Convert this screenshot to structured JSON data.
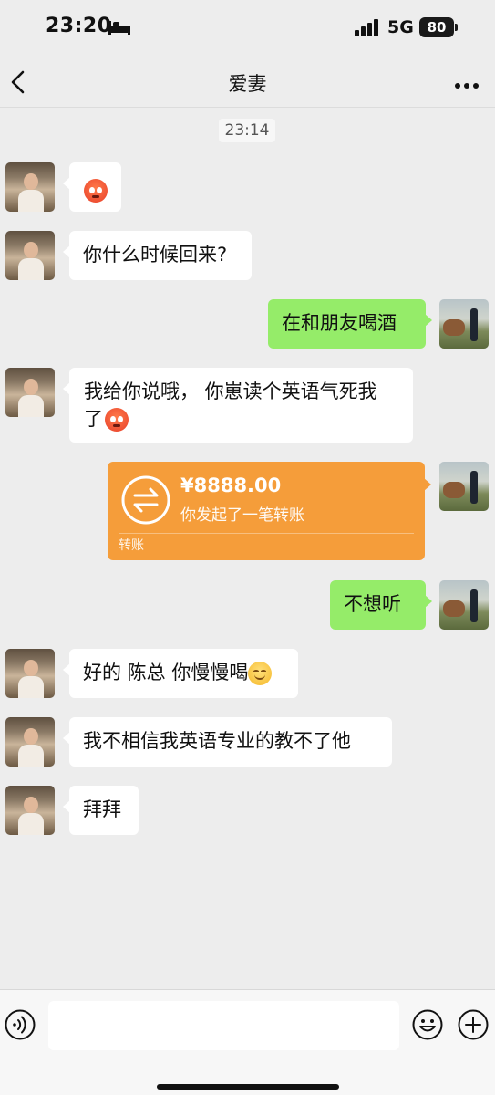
{
  "status_bar": {
    "time": "23:20",
    "network": "5G",
    "battery": "80"
  },
  "nav": {
    "title": "爱妻"
  },
  "chat": {
    "timestamp": "23:14",
    "messages": [
      {
        "sender": "other",
        "type": "emoji",
        "emoji": "angry-face"
      },
      {
        "sender": "other",
        "type": "text",
        "text": "你什么时候回来?"
      },
      {
        "sender": "me",
        "type": "text",
        "text": "在和朋友喝酒"
      },
      {
        "sender": "other",
        "type": "text",
        "line1": "我给你说哦，  你崽读个英语气死我",
        "line2": "了",
        "emoji": "angry-face"
      },
      {
        "sender": "me",
        "type": "transfer",
        "amount": "¥8888.00",
        "desc": "你发起了一笔转账",
        "label": "转账"
      },
      {
        "sender": "me",
        "type": "text",
        "text": "不想听"
      },
      {
        "sender": "other",
        "type": "text",
        "text": "好的 陈总 你慢慢喝",
        "emoji": "smiling-face"
      },
      {
        "sender": "other",
        "type": "text",
        "text": "我不相信我英语专业的教不了他"
      },
      {
        "sender": "other",
        "type": "text",
        "text": "拜拜"
      }
    ]
  },
  "icons": {
    "back": "chevron-left-icon",
    "more": "more-dots-icon",
    "voice": "voice-icon",
    "emoji": "emoji-icon",
    "plus": "plus-icon"
  },
  "colors": {
    "background": "#ededed",
    "my_bubble": "#95ec69",
    "their_bubble": "#ffffff",
    "transfer": "#f59d3a"
  }
}
